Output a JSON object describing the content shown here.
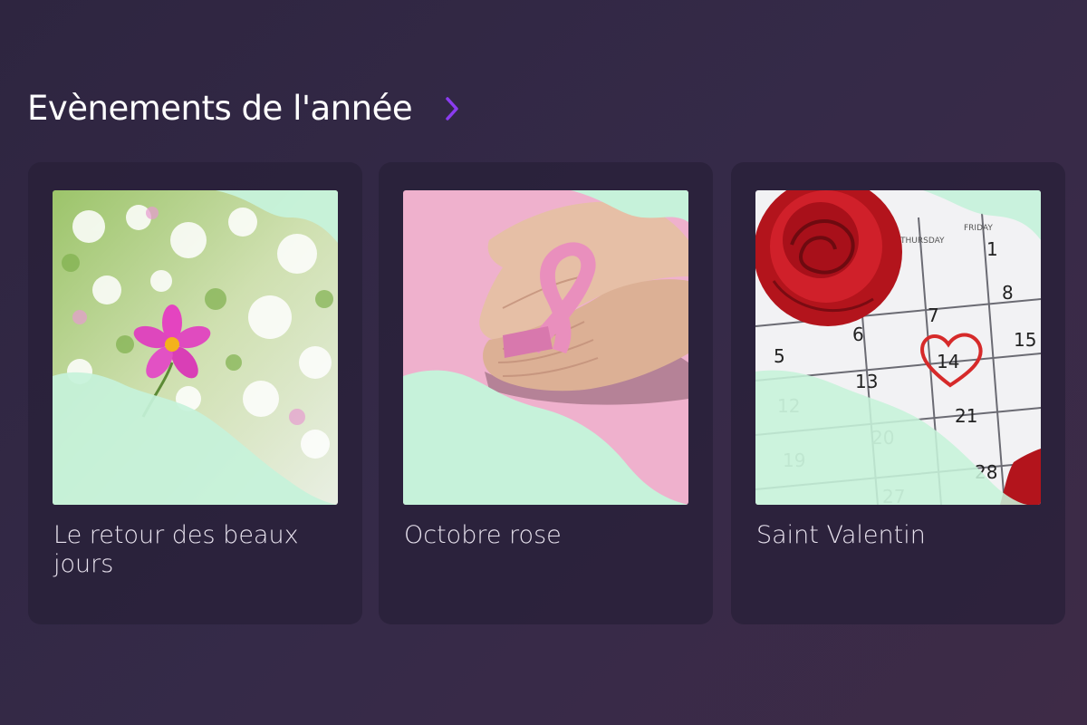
{
  "section": {
    "title": "Evènements de l'année",
    "icon": "chevron-right-icon",
    "accent_color": "#8b3cf0"
  },
  "colors": {
    "background": "#352a48",
    "card": "#2b2339",
    "mint_overlay": "#c6f2da"
  },
  "cards": [
    {
      "title": "Le retour des beaux jours",
      "image": "spring-flowers-image"
    },
    {
      "title": "Octobre rose",
      "image": "pink-ribbon-hands-image"
    },
    {
      "title": "Saint Valentin",
      "image": "rose-calendar-image"
    }
  ],
  "calendar": {
    "headers": [
      "THURSDAY",
      "FRIDAY"
    ],
    "days": [
      "1",
      "8",
      "7",
      "6",
      "5",
      "15",
      "14",
      "13",
      "12",
      "21",
      "20",
      "19",
      "28",
      "27"
    ]
  }
}
